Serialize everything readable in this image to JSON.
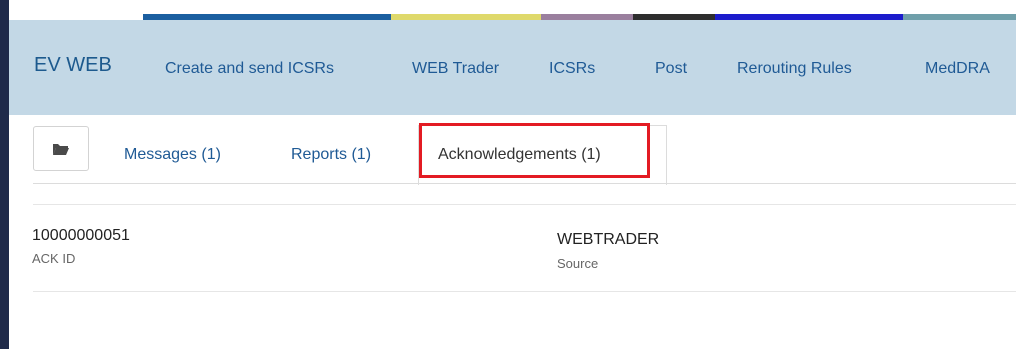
{
  "app": {
    "brand": "EV WEB"
  },
  "nav": {
    "items": [
      {
        "label": "Create and send ICSRs"
      },
      {
        "label": "WEB Trader"
      },
      {
        "label": "ICSRs"
      },
      {
        "label": "Post"
      },
      {
        "label": "Rerouting Rules"
      },
      {
        "label": "MedDRA"
      }
    ]
  },
  "accent_colors": [
    "#1b5fa0",
    "#dfd96b",
    "#9a7f9e",
    "#2e2e2e",
    "#1c1ccc",
    "#6f9faa"
  ],
  "toolbar": {
    "folder_icon": "folder-open-icon"
  },
  "tabs": [
    {
      "label": "Messages (1)"
    },
    {
      "label": "Reports (1)"
    },
    {
      "label": "Acknowledgements (1)",
      "active": true
    }
  ],
  "record": {
    "ack_id_value": "10000000051",
    "ack_id_label": "ACK ID",
    "source_value": "WEBTRADER",
    "source_label": "Source"
  },
  "highlight_color": "#e31b23"
}
